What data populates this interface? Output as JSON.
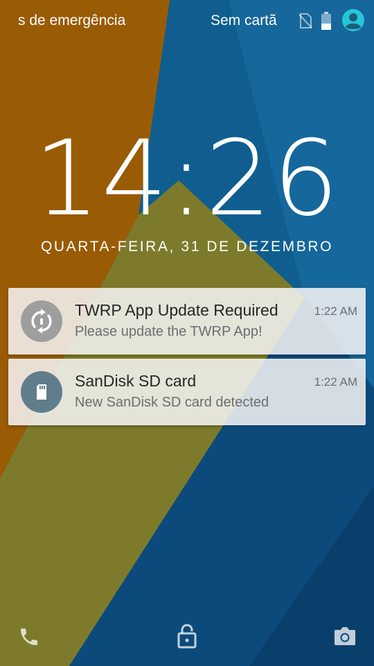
{
  "status_bar": {
    "emergency_text": "s de emergência",
    "carrier_text": "Sem cartã",
    "icons": [
      "no-sim-icon",
      "battery-icon",
      "user-avatar-icon"
    ]
  },
  "lockscreen": {
    "time": "14:26",
    "date": "QUARTA-FEIRA, 31 DE DEZEMBRO"
  },
  "notifications": [
    {
      "title": "TWRP App Update Required",
      "text": "Please update the TWRP App!",
      "time": "1:22 AM",
      "icon": "update-sync-icon",
      "icon_color": "#9e9e9e"
    },
    {
      "title": "SanDisk SD card",
      "text": "New SanDisk SD card detected",
      "time": "1:22 AM",
      "icon": "sd-card-icon",
      "icon_color": "#607d8b"
    }
  ],
  "bottom_actions": [
    "phone-icon",
    "unlock-icon",
    "camera-icon"
  ],
  "colors": {
    "avatar_accent": "#26c6da",
    "wallpaper_blue": "#0f5e8f",
    "wallpaper_orange": "#a05c06",
    "wallpaper_olive": "#7a7a2a"
  }
}
